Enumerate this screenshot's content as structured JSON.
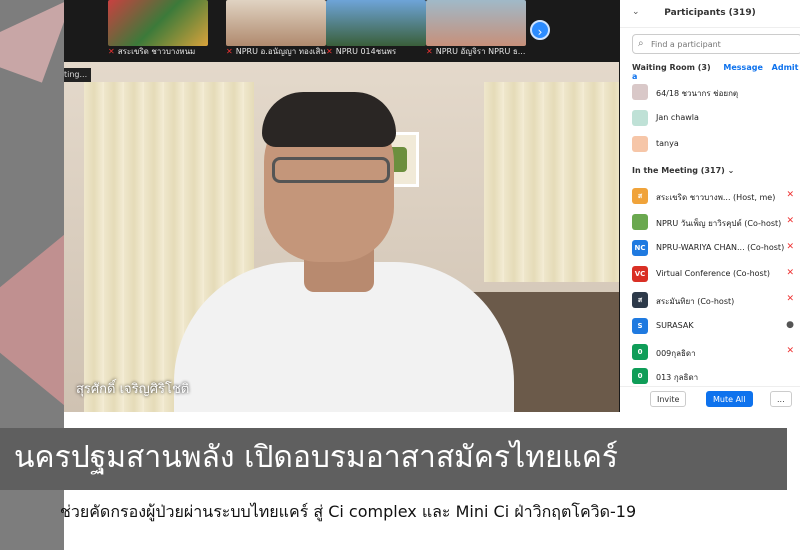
{
  "meeting": {
    "thumbnails": [
      {
        "name": "สระเขริด ชาวบางหนม"
      },
      {
        "name": "NPRU อ.อนัญญา ทองเสินา"
      },
      {
        "name": "NPRU 014ชนพร"
      },
      {
        "name": "NPRU อัญจิรา NPRU ธ..."
      }
    ],
    "speaker_name": "สุรศักดิ์ เจริญศิริโชติ",
    "recording_tag": "ting..."
  },
  "participants": {
    "title": "Participants (319)",
    "search_placeholder": "Find a participant",
    "waiting_room": {
      "label": "Waiting Room (3)",
      "message": "Message",
      "admit_all": "Admit a"
    },
    "waiting": [
      {
        "name": "64/18 ชวนากร ช่อยกตุ",
        "avatar": "",
        "color": "#d9c8c8"
      },
      {
        "name": "Jan chawla",
        "avatar": "",
        "color": "#bfe1d6"
      },
      {
        "name": "tanya",
        "avatar": "",
        "color": "#f6c6a8"
      }
    ],
    "in_meeting_label": "In the Meeting (317)",
    "in_meeting": [
      {
        "name": "สระเขริด ชาวบางพ... (Host, me)",
        "avatar": "ส",
        "color": "#f0a33a"
      },
      {
        "name": "NPRU วันเพ็ญ ยาวิรคุปต์ (Co-host)",
        "avatar": "",
        "color": "#6aa84f"
      },
      {
        "name": "NPRU-WARIYA CHAN... (Co-host)",
        "avatar": "NC",
        "color": "#1f7ae0"
      },
      {
        "name": "Virtual Conference (Co-host)",
        "avatar": "VC",
        "color": "#d93025"
      },
      {
        "name": "สระมันทิยา (Co-host)",
        "avatar": "ส",
        "color": "#2d3a4a"
      },
      {
        "name": "SURASAK",
        "avatar": "S",
        "color": "#1f7ae0"
      },
      {
        "name": "009กุลธิดา",
        "avatar": "0",
        "color": "#0f9d58"
      },
      {
        "name": "013 กุลธิดา",
        "avatar": "0",
        "color": "#0f9d58"
      }
    ],
    "invite": "Invite",
    "mute_all": "Mute All",
    "more": "..."
  },
  "headline": "นครปฐมสานพลัง เปิดอบรมอาสาสมัครไทยแคร์",
  "subhead": "ช่วยคัดกรองผู้ป่วยผ่านระบบไทยแคร์ สู่ Ci complex และ Mini Ci ฝ่าวิกฤตโควิด-19"
}
